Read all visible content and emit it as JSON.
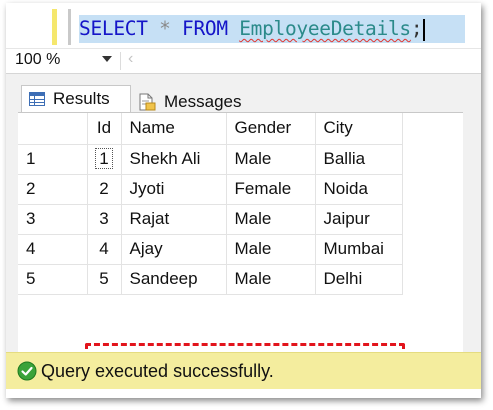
{
  "editor": {
    "code_tokens": {
      "select": "SELECT",
      "star": "*",
      "from": "FROM",
      "table": "EmployeeDetails",
      "semicolon": ";"
    }
  },
  "toolbar": {
    "zoom": "100 %"
  },
  "tabs": {
    "results_label": "Results",
    "messages_label": "Messages"
  },
  "grid": {
    "columns": [
      "Id",
      "Name",
      "Gender",
      "City"
    ],
    "rows": [
      {
        "num": "1",
        "id": "1",
        "name": "Shekh Ali",
        "gender": "Male",
        "city": "Ballia"
      },
      {
        "num": "2",
        "id": "2",
        "name": "Jyoti",
        "gender": "Female",
        "city": "Noida"
      },
      {
        "num": "3",
        "id": "3",
        "name": "Rajat",
        "gender": "Male",
        "city": "Jaipur"
      },
      {
        "num": "4",
        "id": "4",
        "name": "Ajay",
        "gender": "Male",
        "city": "Mumbai"
      },
      {
        "num": "5",
        "id": "5",
        "name": "Sandeep",
        "gender": "Male",
        "city": "Delhi"
      }
    ]
  },
  "status": {
    "message": "Query executed successfully.",
    "color": "#f4ed9e"
  },
  "highlight": {
    "color": "#e2141c"
  }
}
